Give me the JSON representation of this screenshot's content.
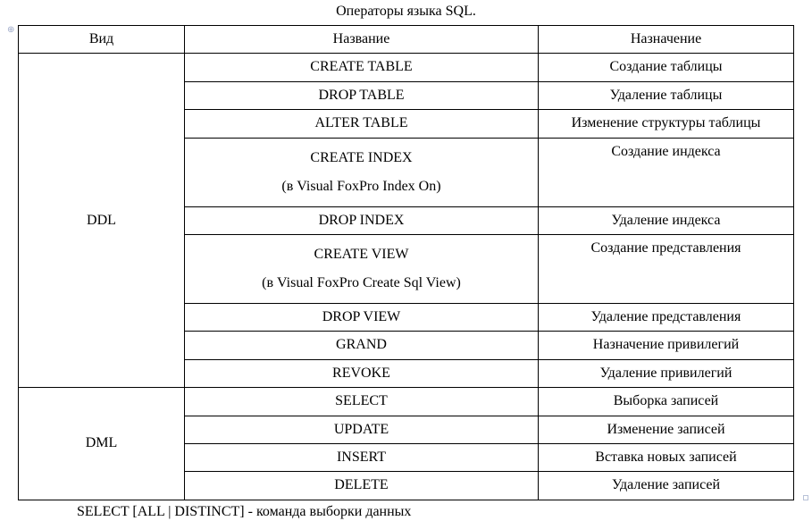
{
  "title": "Операторы языка SQL.",
  "headers": {
    "col1": "Вид",
    "col2": "Название",
    "col3": "Назначение"
  },
  "groups": [
    {
      "label": "DDL",
      "rows": [
        {
          "name": "CREATE TABLE",
          "purpose": "Создание таблицы"
        },
        {
          "name": "DROP TABLE",
          "purpose": "Удаление таблицы"
        },
        {
          "name": "ALTER TABLE",
          "purpose": "Изменение структуры таблицы"
        },
        {
          "name_l1": "CREATE INDEX",
          "name_l2": "(в Visual FoxPro Index On)",
          "purpose": "Создание индекса"
        },
        {
          "name": "DROP INDEX",
          "purpose": "Удаление индекса"
        },
        {
          "name_l1": "CREATE VIEW",
          "name_l2": "(в Visual FoxPro Create Sql View)",
          "purpose": "Создание представления"
        },
        {
          "name": "DROP VIEW",
          "purpose": "Удаление представления"
        },
        {
          "name": "GRAND",
          "purpose": "Назначение привилегий"
        },
        {
          "name": "REVOKE",
          "purpose": "Удаление привилегий"
        }
      ]
    },
    {
      "label": "DML",
      "rows": [
        {
          "name": "SELECT",
          "purpose": "Выборка записей"
        },
        {
          "name": "UPDATE",
          "purpose": "Изменение записей"
        },
        {
          "name": "INSERT",
          "purpose": "Вставка новых записей"
        },
        {
          "name": "DELETE",
          "purpose": "Удаление записей"
        }
      ]
    }
  ],
  "footer": "SELECT [ALL | DISTINCT] - команда выборки данных"
}
